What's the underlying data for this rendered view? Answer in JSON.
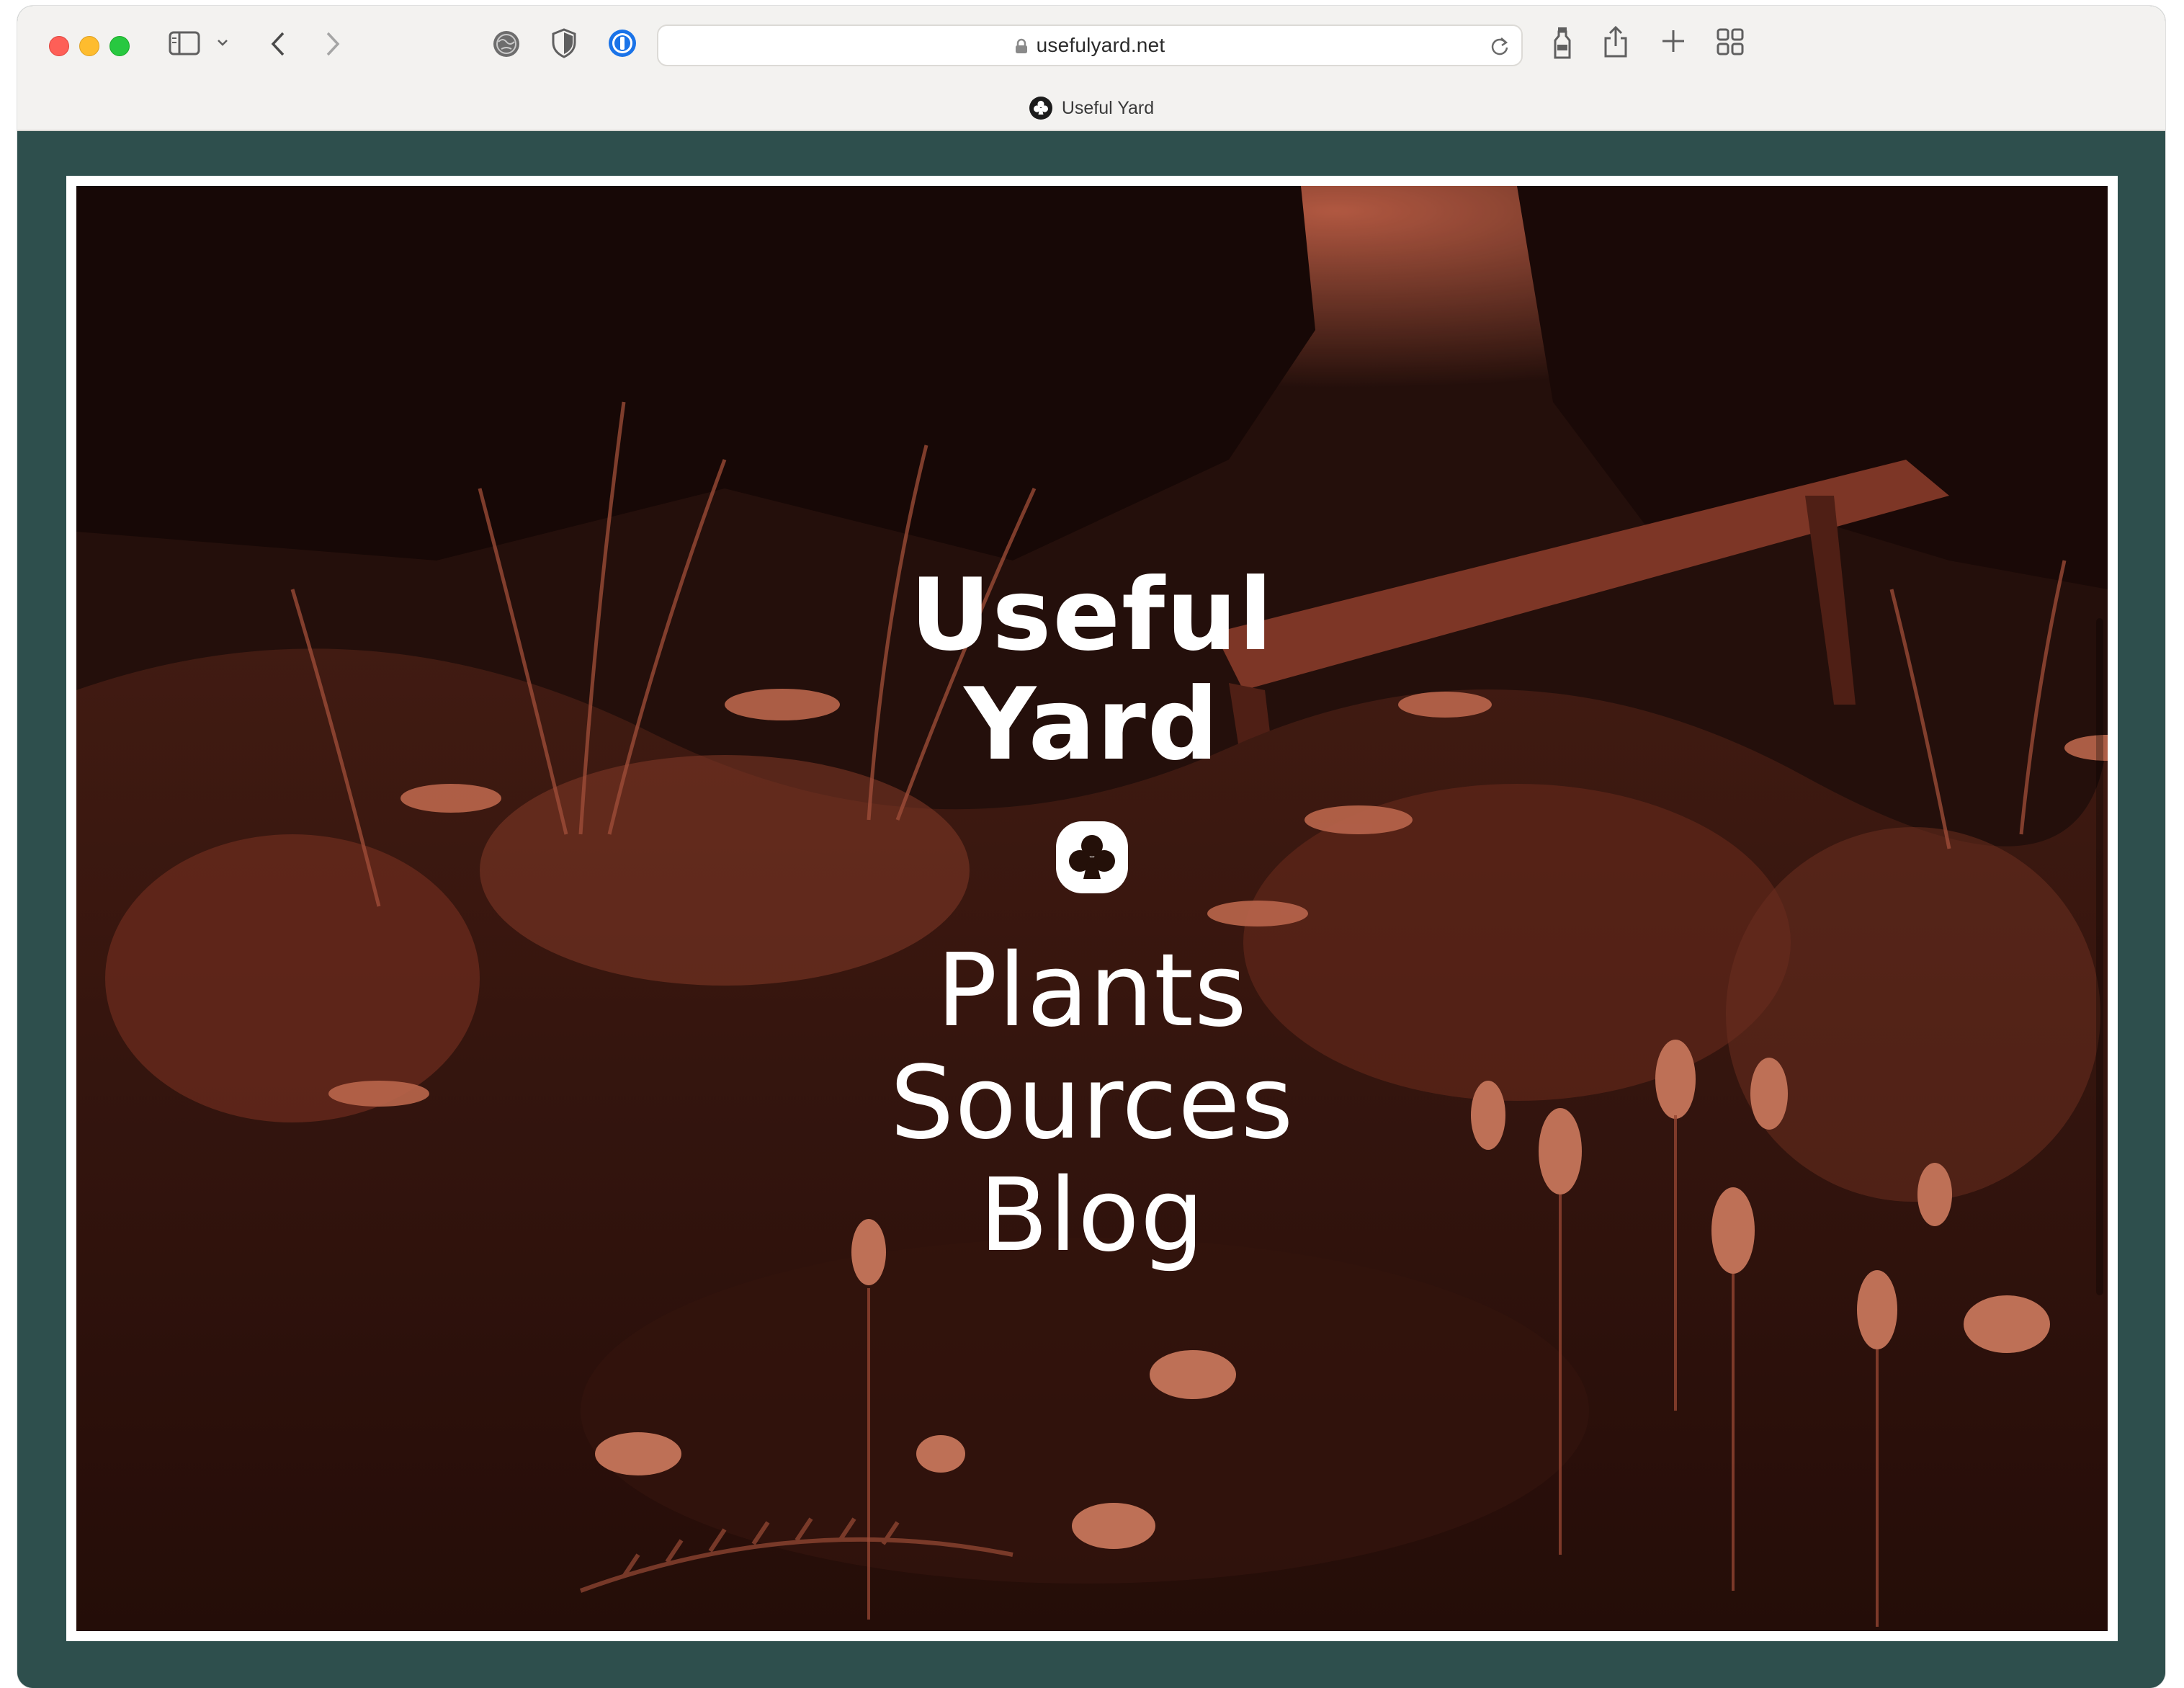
{
  "browser": {
    "url": "usefulyard.net",
    "tab_title": "Useful Yard",
    "icons": {
      "sidebar": "sidebar-icon",
      "sidebar_menu": "chevron-down-icon",
      "back": "chevron-left-icon",
      "forward": "chevron-right-icon",
      "extension1": "globe-icon",
      "extension2": "shield-icon",
      "extension3": "password-manager-icon",
      "lock": "lock-icon",
      "reload": "reload-icon",
      "extension4": "bottle-icon",
      "share": "share-icon",
      "new_tab": "plus-icon",
      "tab_overview": "grid-icon"
    }
  },
  "site": {
    "title_line1": "Useful",
    "title_line2": "Yard",
    "logo": "club-icon",
    "nav": [
      {
        "label": "Plants"
      },
      {
        "label": "Sources"
      },
      {
        "label": "Blog"
      }
    ]
  },
  "colors": {
    "page_background": "#2e4f4d",
    "photo_tint": "#c9644a",
    "photo_shadow": "#2a120d",
    "frame": "#ffffff",
    "text": "#ffffff"
  }
}
